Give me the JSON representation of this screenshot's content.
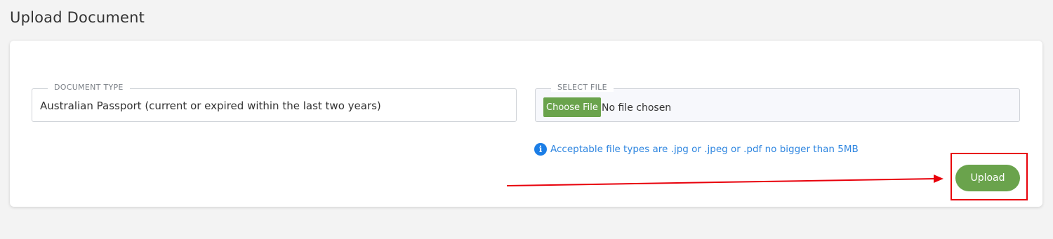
{
  "page": {
    "title": "Upload Document"
  },
  "document_type": {
    "legend": "DOCUMENT TYPE",
    "value": "Australian Passport (current or expired within the last two years)"
  },
  "select_file": {
    "legend": "SELECT FILE",
    "button_label": "Choose File",
    "status": "No file chosen"
  },
  "hint": {
    "icon": "info-icon",
    "icon_glyph": "i",
    "text": "Acceptable file types are .jpg or .jpeg or .pdf no bigger than 5MB"
  },
  "actions": {
    "upload_label": "Upload"
  },
  "colors": {
    "accent_green": "#6aa34c",
    "info_blue": "#2f86e0",
    "annotation_red": "#e8000b"
  }
}
